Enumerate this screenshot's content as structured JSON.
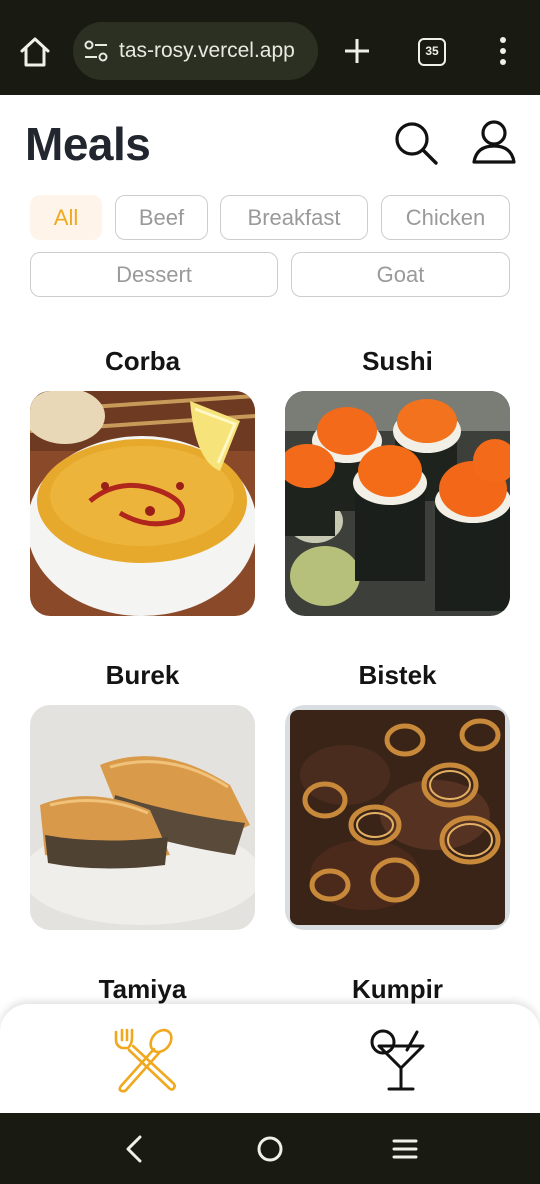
{
  "browser": {
    "url": "tas-rosy.vercel.app",
    "tab_count": "35",
    "icons": [
      "home-icon",
      "site-settings-icon",
      "plus-icon",
      "tabs-icon",
      "more-vert-icon"
    ]
  },
  "header": {
    "title": "Meals",
    "icons": [
      "search-icon",
      "user-icon"
    ]
  },
  "categories": {
    "selected": "All",
    "items": [
      "All",
      "Beef",
      "Breakfast",
      "Chicken",
      "Dessert",
      "Goat"
    ]
  },
  "meals": [
    {
      "name": "Corba"
    },
    {
      "name": "Sushi"
    },
    {
      "name": "Burek"
    },
    {
      "name": "Bistek"
    },
    {
      "name": "Tamiya"
    },
    {
      "name": "Kumpir"
    }
  ],
  "bottom_nav": {
    "items": [
      {
        "icon": "fork-spoon-icon",
        "active": true
      },
      {
        "icon": "cocktail-icon",
        "active": false
      }
    ]
  },
  "colors": {
    "accent": "#f0a81f",
    "chip_active_bg": "#fff4ea",
    "chrome_bg": "#191a12",
    "title": "#22262e"
  }
}
